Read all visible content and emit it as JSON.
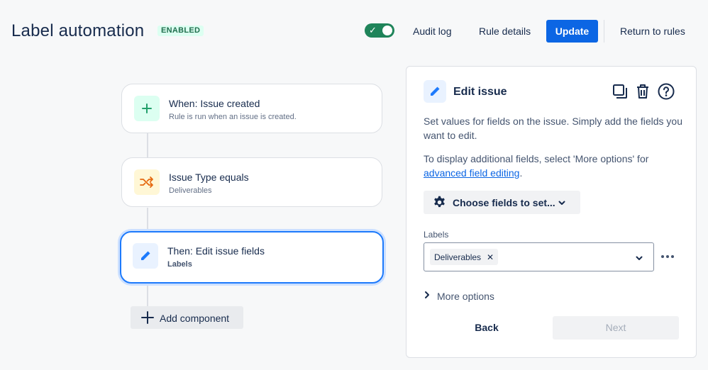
{
  "header": {
    "title": "Label automation",
    "status": "ENABLED",
    "toggle_state": "on",
    "audit_log": "Audit log",
    "rule_details": "Rule details",
    "update": "Update",
    "return": "Return to rules"
  },
  "flow": {
    "trigger": {
      "title": "When: Issue created",
      "subtitle": "Rule is run when an issue is created.",
      "icon": "plus-icon"
    },
    "condition": {
      "title": "Issue Type equals",
      "subtitle": "Deliverables",
      "icon": "shuffle-icon"
    },
    "action": {
      "title": "Then: Edit issue fields",
      "subtitle": "Labels",
      "icon": "pencil-icon"
    },
    "add_component": "Add component"
  },
  "panel": {
    "title": "Edit issue",
    "description": "Set values for fields on the issue. Simply add the fields you want to edit.",
    "more_info_prefix": "To display additional fields, select 'More options' for ",
    "more_info_link": "advanced field editing",
    "more_info_suffix": ".",
    "choose_fields": "Choose fields to set...",
    "field_label": "Labels",
    "selected_tag": "Deliverables",
    "more_options": "More options",
    "back": "Back",
    "next": "Next"
  },
  "colors": {
    "accent": "#0c66e4",
    "toggle_on": "#1f845a",
    "enabled_badge_bg": "#dcfff1",
    "trigger_icon_bg": "#dcfff1",
    "condition_icon_bg": "#fff7d6",
    "action_icon_bg": "#e9f2ff"
  }
}
